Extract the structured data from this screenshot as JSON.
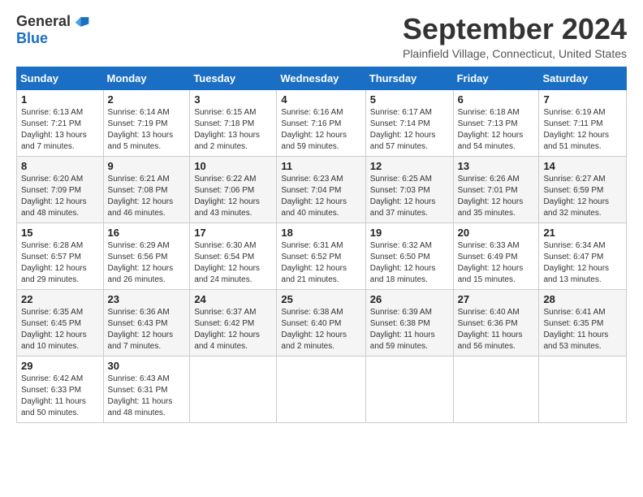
{
  "logo": {
    "general": "General",
    "blue": "Blue"
  },
  "title": {
    "month": "September 2024",
    "location": "Plainfield Village, Connecticut, United States"
  },
  "weekdays": [
    "Sunday",
    "Monday",
    "Tuesday",
    "Wednesday",
    "Thursday",
    "Friday",
    "Saturday"
  ],
  "weeks": [
    [
      {
        "day": "1",
        "sunrise": "6:13 AM",
        "sunset": "7:21 PM",
        "daylight": "13 hours and 7 minutes."
      },
      {
        "day": "2",
        "sunrise": "6:14 AM",
        "sunset": "7:19 PM",
        "daylight": "13 hours and 5 minutes."
      },
      {
        "day": "3",
        "sunrise": "6:15 AM",
        "sunset": "7:18 PM",
        "daylight": "13 hours and 2 minutes."
      },
      {
        "day": "4",
        "sunrise": "6:16 AM",
        "sunset": "7:16 PM",
        "daylight": "12 hours and 59 minutes."
      },
      {
        "day": "5",
        "sunrise": "6:17 AM",
        "sunset": "7:14 PM",
        "daylight": "12 hours and 57 minutes."
      },
      {
        "day": "6",
        "sunrise": "6:18 AM",
        "sunset": "7:13 PM",
        "daylight": "12 hours and 54 minutes."
      },
      {
        "day": "7",
        "sunrise": "6:19 AM",
        "sunset": "7:11 PM",
        "daylight": "12 hours and 51 minutes."
      }
    ],
    [
      {
        "day": "8",
        "sunrise": "6:20 AM",
        "sunset": "7:09 PM",
        "daylight": "12 hours and 48 minutes."
      },
      {
        "day": "9",
        "sunrise": "6:21 AM",
        "sunset": "7:08 PM",
        "daylight": "12 hours and 46 minutes."
      },
      {
        "day": "10",
        "sunrise": "6:22 AM",
        "sunset": "7:06 PM",
        "daylight": "12 hours and 43 minutes."
      },
      {
        "day": "11",
        "sunrise": "6:23 AM",
        "sunset": "7:04 PM",
        "daylight": "12 hours and 40 minutes."
      },
      {
        "day": "12",
        "sunrise": "6:25 AM",
        "sunset": "7:03 PM",
        "daylight": "12 hours and 37 minutes."
      },
      {
        "day": "13",
        "sunrise": "6:26 AM",
        "sunset": "7:01 PM",
        "daylight": "12 hours and 35 minutes."
      },
      {
        "day": "14",
        "sunrise": "6:27 AM",
        "sunset": "6:59 PM",
        "daylight": "12 hours and 32 minutes."
      }
    ],
    [
      {
        "day": "15",
        "sunrise": "6:28 AM",
        "sunset": "6:57 PM",
        "daylight": "12 hours and 29 minutes."
      },
      {
        "day": "16",
        "sunrise": "6:29 AM",
        "sunset": "6:56 PM",
        "daylight": "12 hours and 26 minutes."
      },
      {
        "day": "17",
        "sunrise": "6:30 AM",
        "sunset": "6:54 PM",
        "daylight": "12 hours and 24 minutes."
      },
      {
        "day": "18",
        "sunrise": "6:31 AM",
        "sunset": "6:52 PM",
        "daylight": "12 hours and 21 minutes."
      },
      {
        "day": "19",
        "sunrise": "6:32 AM",
        "sunset": "6:50 PM",
        "daylight": "12 hours and 18 minutes."
      },
      {
        "day": "20",
        "sunrise": "6:33 AM",
        "sunset": "6:49 PM",
        "daylight": "12 hours and 15 minutes."
      },
      {
        "day": "21",
        "sunrise": "6:34 AM",
        "sunset": "6:47 PM",
        "daylight": "12 hours and 13 minutes."
      }
    ],
    [
      {
        "day": "22",
        "sunrise": "6:35 AM",
        "sunset": "6:45 PM",
        "daylight": "12 hours and 10 minutes."
      },
      {
        "day": "23",
        "sunrise": "6:36 AM",
        "sunset": "6:43 PM",
        "daylight": "12 hours and 7 minutes."
      },
      {
        "day": "24",
        "sunrise": "6:37 AM",
        "sunset": "6:42 PM",
        "daylight": "12 hours and 4 minutes."
      },
      {
        "day": "25",
        "sunrise": "6:38 AM",
        "sunset": "6:40 PM",
        "daylight": "12 hours and 2 minutes."
      },
      {
        "day": "26",
        "sunrise": "6:39 AM",
        "sunset": "6:38 PM",
        "daylight": "11 hours and 59 minutes."
      },
      {
        "day": "27",
        "sunrise": "6:40 AM",
        "sunset": "6:36 PM",
        "daylight": "11 hours and 56 minutes."
      },
      {
        "day": "28",
        "sunrise": "6:41 AM",
        "sunset": "6:35 PM",
        "daylight": "11 hours and 53 minutes."
      }
    ],
    [
      {
        "day": "29",
        "sunrise": "6:42 AM",
        "sunset": "6:33 PM",
        "daylight": "11 hours and 50 minutes."
      },
      {
        "day": "30",
        "sunrise": "6:43 AM",
        "sunset": "6:31 PM",
        "daylight": "11 hours and 48 minutes."
      },
      null,
      null,
      null,
      null,
      null
    ]
  ]
}
